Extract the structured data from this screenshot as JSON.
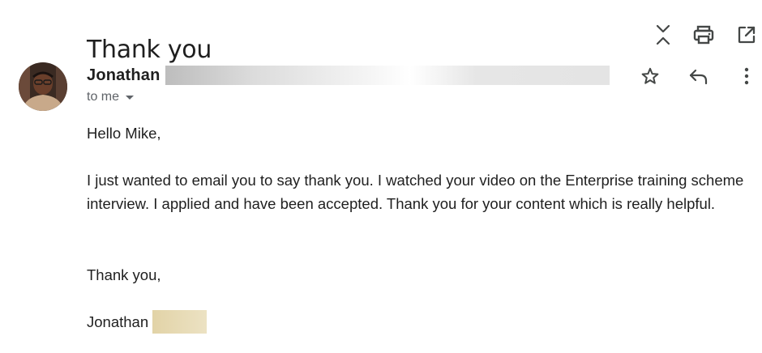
{
  "email": {
    "subject": "Thank you",
    "sender": {
      "name": "Jonathan",
      "avatar": "avatar-photo"
    },
    "recipient_label": "to me",
    "body": {
      "greeting": "Hello Mike,",
      "paragraph": "I just wanted to email you to say thank you. I watched your video on the Enterprise training scheme interview. I applied and have been accepted. Thank you for your content which is really helpful.",
      "closing": "Thank you,",
      "signature": "Jonathan"
    }
  },
  "actions": {
    "top": [
      "collapse-all-icon",
      "print-icon",
      "open-in-new-window-icon"
    ],
    "message": [
      "star-icon",
      "reply-icon",
      "more-vert-icon"
    ]
  },
  "colors": {
    "text": "#1f1f1f",
    "secondary_text": "#5f6368",
    "icon": "#444746",
    "sender_redaction": "#d9d9d9",
    "signature_redaction": "#e2d3a7"
  }
}
